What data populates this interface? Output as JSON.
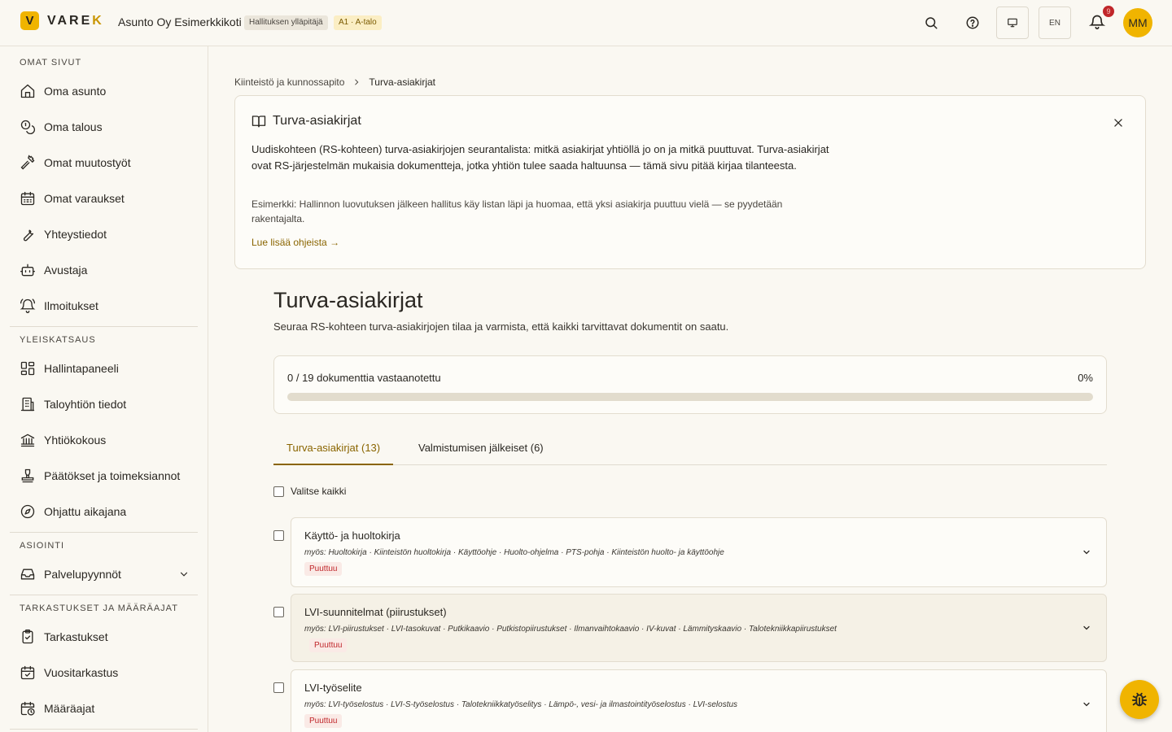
{
  "header": {
    "logo_mark": "V",
    "logo_text_main": "VARE",
    "logo_text_accent": "K",
    "org_name": "Asunto Oy Esimerkkikoti",
    "role_badge": "Hallituksen ylläpitäjä",
    "unit_badge": "A1 · A-talo",
    "language": "EN",
    "notification_count": "9",
    "avatar_initials": "MM"
  },
  "sidebar": {
    "sections": [
      {
        "title": "OMAT SIVUT",
        "items": [
          {
            "label": "Oma asunto",
            "icon": "home-icon"
          },
          {
            "label": "Oma talous",
            "icon": "coins-icon"
          },
          {
            "label": "Omat muutostyöt",
            "icon": "hammer-icon"
          },
          {
            "label": "Omat varaukset",
            "icon": "calendar-icon"
          },
          {
            "label": "Yhteystiedot",
            "icon": "wrench-icon"
          },
          {
            "label": "Avustaja",
            "icon": "bot-icon"
          },
          {
            "label": "Ilmoitukset",
            "icon": "bell-icon"
          }
        ]
      },
      {
        "title": "YLEISKATSAUS",
        "items": [
          {
            "label": "Hallintapaneeli",
            "icon": "dashboard-icon"
          },
          {
            "label": "Taloyhtiön tiedot",
            "icon": "building-icon"
          },
          {
            "label": "Yhtiökokous",
            "icon": "landmark-icon"
          },
          {
            "label": "Päätökset ja toimeksiannot",
            "icon": "stamp-icon"
          },
          {
            "label": "Ohjattu aikajana",
            "icon": "compass-icon"
          }
        ]
      },
      {
        "title": "ASIOINTI",
        "items": [
          {
            "label": "Palvelupyynnöt",
            "icon": "inbox-icon"
          }
        ]
      },
      {
        "title": "TARKASTUKSET JA MÄÄRÄAJAT",
        "items": [
          {
            "label": "Tarkastukset",
            "icon": "clipboard-check-icon"
          },
          {
            "label": "Vuositarkastus",
            "icon": "calendar-check-icon"
          },
          {
            "label": "Määräajat",
            "icon": "calendar-clock-icon"
          }
        ]
      }
    ]
  },
  "breadcrumb": {
    "parent": "Kiinteistö ja kunnossapito",
    "current": "Turva-asiakirjat"
  },
  "help": {
    "title": "Turva-asiakirjat",
    "description": "Uudiskohteen (RS-kohteen) turva-asiakirjojen seurantalista: mitkä asiakirjat yhtiöllä jo on ja mitkä puuttuvat. Turva-asiakirjat ovat RS-järjestelmän mukaisia dokumentteja, jotka yhtiön tulee saada haltuunsa — tämä sivu pitää kirjaa tilanteesta.",
    "example": "Esimerkki: Hallinnon luovutuksen jälkeen hallitus käy listan läpi ja huomaa, että yksi asiakirja puuttuu vielä — se pyydetään rakentajalta.",
    "link": "Lue lisää ohjeista →"
  },
  "page": {
    "title": "Turva-asiakirjat",
    "subtitle": "Seuraa RS-kohteen turva-asiakirjojen tilaa ja varmista, että kaikki tarvittavat dokumentit on saatu."
  },
  "progress": {
    "text": "0 / 19 dokumenttia vastaanotettu",
    "percent_label": "0%",
    "fraction": 0
  },
  "tabs": [
    {
      "label": "Turva-asiakirjat (13)",
      "active": true
    },
    {
      "label": "Valmistumisen jälkeiset (6)",
      "active": false
    }
  ],
  "select_all_label": "Valitse kaikki",
  "documents": [
    {
      "name": "Käyttö- ja huoltokirja",
      "aliases": "myös: Huoltokirja · Kiinteistön huoltokirja · Käyttöohje · Huolto-ohjelma · PTS-pohja · Kiinteistön huolto- ja käyttöohje",
      "status": "Puuttuu"
    },
    {
      "name": "LVI-suunnitelmat (piirustukset)",
      "aliases": "myös: LVI-piirustukset · LVI-tasokuvat · Putkikaavio · Putkistopiirustukset · Ilmanvaihtokaavio · IV-kuvat · Lämmityskaavio · Talotekniikkapiirustukset",
      "status": "Puuttuu"
    },
    {
      "name": "LVI-työselite",
      "aliases": "myös: LVI-työselostus · LVI-S-työselostus · Talotekniikkatyöselitys · Lämpö-, vesi- ja ilmastointityöselostus · LVI-selostus",
      "status": "Puuttuu"
    }
  ],
  "colors": {
    "accent": "#f0b400",
    "accent_text": "#8a6500",
    "danger": "#c0262a",
    "background": "#faf8f2"
  }
}
